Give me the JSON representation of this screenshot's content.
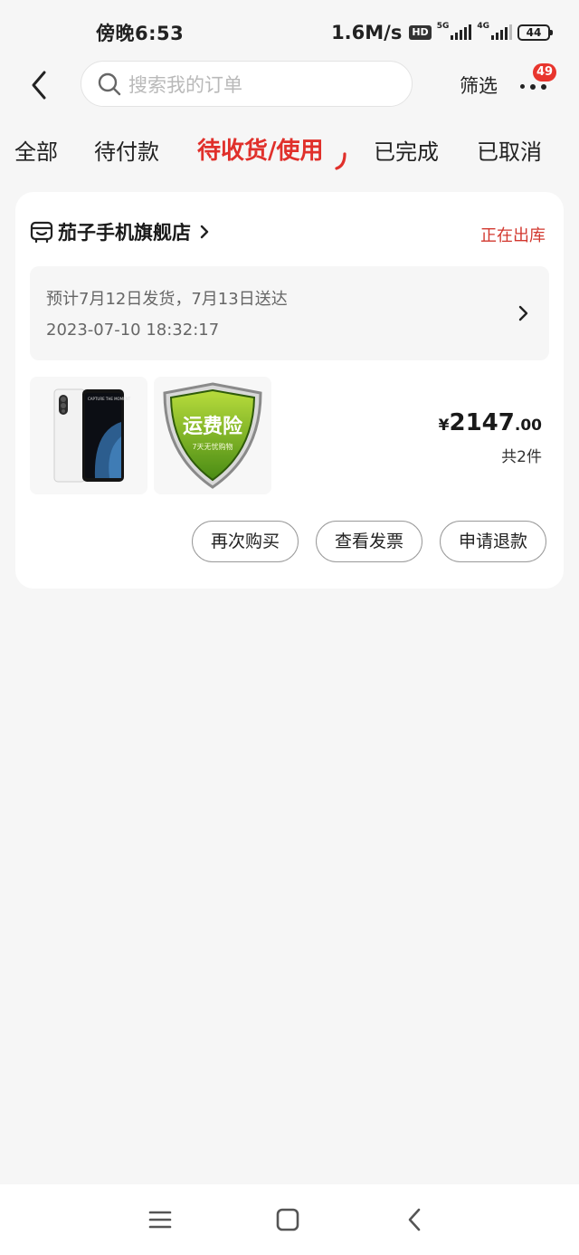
{
  "status_bar": {
    "time": "傍晚6:53",
    "speed": "1.6M/s",
    "hd_badge": "HD",
    "net_5g": "5G",
    "net_4g": "4G",
    "battery": "44"
  },
  "header": {
    "search_placeholder": "搜索我的订单",
    "filter_label": "筛选",
    "more_badge": "49"
  },
  "tabs": [
    {
      "label": "全部",
      "active": false
    },
    {
      "label": "待付款",
      "active": false
    },
    {
      "label": "待收货/使用",
      "active": true
    },
    {
      "label": "已完成",
      "active": false
    },
    {
      "label": "已取消",
      "active": false
    }
  ],
  "order": {
    "shop_name": "茄子手机旗舰店",
    "status": "正在出库",
    "delivery_estimate": "预计7月12日发货，7月13日送达",
    "order_time": "2023-07-10 18:32:17",
    "products": [
      {
        "name": "phone",
        "screen_text": "CAPTURE THE MOMENT"
      },
      {
        "name": "shipping-insurance",
        "badge_text": "运费险",
        "sub_text": "7天无忧购物"
      }
    ],
    "price_symbol": "¥",
    "price_integer": "2147",
    "price_decimal": ".00",
    "quantity": "共2件",
    "actions": {
      "rebuy": "再次购买",
      "invoice": "查看发票",
      "refund": "申请退款"
    }
  },
  "colors": {
    "accent": "#e0302b",
    "status": "#d2382f",
    "background": "#f6f6f6"
  }
}
